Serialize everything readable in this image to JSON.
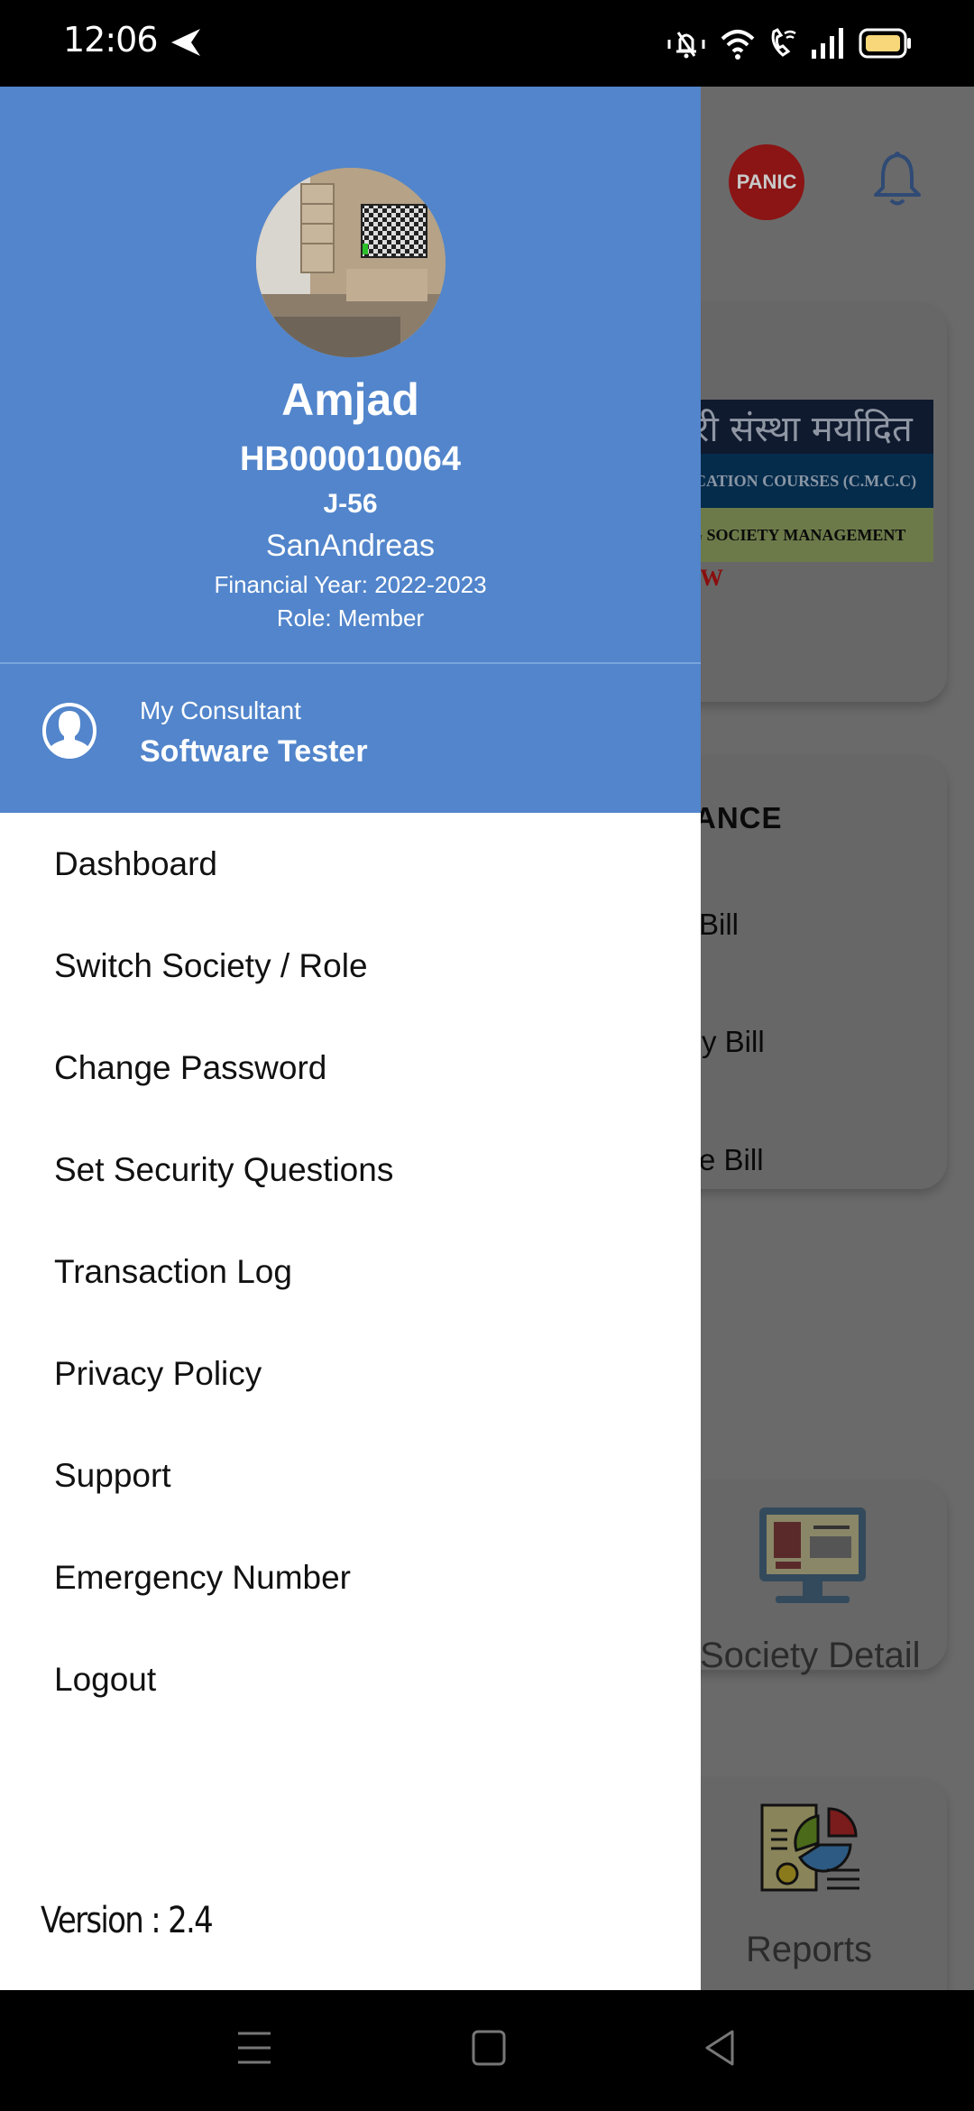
{
  "status_bar": {
    "time": "12:06",
    "icons": [
      "navigation-arrow-icon",
      "mute-icon",
      "wifi-icon",
      "wifi-calling-icon",
      "signal-icon",
      "battery-icon"
    ],
    "battery_color": "#f7d77a"
  },
  "drawer": {
    "header_color": "#5285cb",
    "profile": {
      "name": "Amjad",
      "member_code": "HB000010064",
      "flat": "J-56",
      "society": "SanAndreas",
      "financial_year": "Financial Year: 2022-2023",
      "role": "Role: Member"
    },
    "consultant": {
      "label": "My Consultant",
      "name": "Software Tester"
    },
    "menu_items": [
      {
        "label": "Dashboard"
      },
      {
        "label": "Switch Society / Role"
      },
      {
        "label": "Change Password"
      },
      {
        "label": "Set Security Questions"
      },
      {
        "label": "Transaction Log"
      },
      {
        "label": "Privacy Policy"
      },
      {
        "label": "Support"
      },
      {
        "label": "Emergency Number"
      },
      {
        "label": "Logout"
      }
    ],
    "version": "Version : 2.4"
  },
  "background_app": {
    "panic_label": "PANIC",
    "banner": {
      "row1": "री संस्था मर्यादित",
      "row2": "CATION COURSES (C.M.C.C)",
      "row3": "G SOCIETY MANAGEMENT",
      "tag": "W"
    },
    "maintenance_title": "ANCE",
    "bills": [
      "Bill",
      "y Bill",
      "e Bill"
    ],
    "tiles": [
      "Society Detail",
      "Reports"
    ]
  },
  "nav_bar": {
    "buttons": [
      "recents-icon",
      "home-icon",
      "back-icon"
    ]
  }
}
